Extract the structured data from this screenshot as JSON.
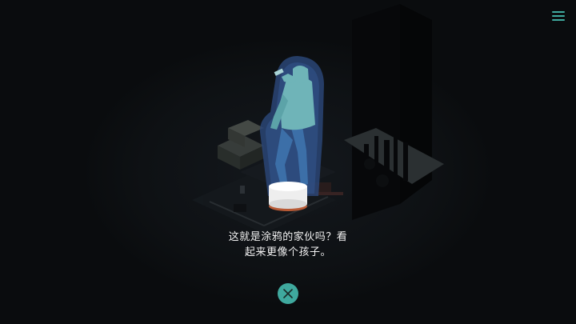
{
  "dialog": {
    "line1": "这就是涂鸦的家伙吗？看",
    "line2": "起来更像个孩子。"
  },
  "icons": {
    "menu": "hamburger-menu-icon",
    "close": "close-x-icon"
  },
  "colors": {
    "accent": "#3fa99e",
    "background": "#0b0d10",
    "figure": "#6fb4b8",
    "hologram_glow": "#3a5a8c",
    "text": "#f2f2f2"
  }
}
